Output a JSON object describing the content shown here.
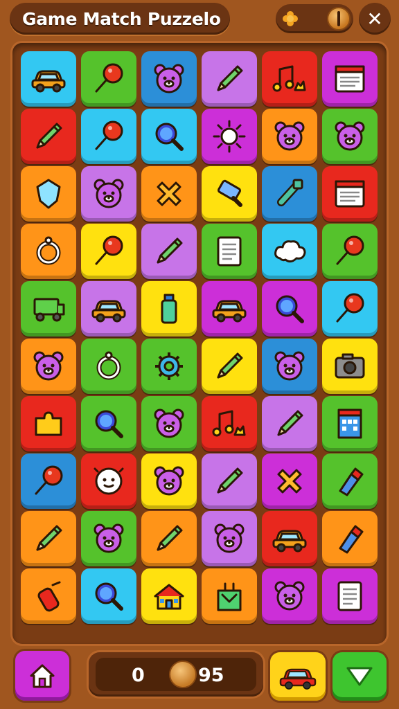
{
  "header": {
    "title": "Game Match Puzzelo"
  },
  "footer": {
    "score_left": "0",
    "score_right": "95"
  },
  "colors": {
    "cyan": "#33c8f2",
    "green": "#55c22c",
    "blue": "#2c8fd8",
    "violet": "#c774e8",
    "red": "#e8281e",
    "magenta": "#cc2fd8",
    "orange": "#ff9418",
    "yellow": "#ffe10f",
    "wood": "#a0561f"
  },
  "board": {
    "rows": [
      [
        "cyan:car-icon",
        "green:lollipop-icon",
        "blue:bear-icon",
        "violet:pencil-icon",
        "red:music-note-icon",
        "magenta:notebook-icon"
      ],
      [
        "red:pencil-icon",
        "cyan:lollipop-icon",
        "cyan:magnifier-icon",
        "magenta:sun-icon",
        "orange:bear-icon",
        "green:bear-icon"
      ],
      [
        "orange:shield-icon",
        "violet:bear-icon",
        "orange:cross-icon",
        "yellow:paint-roller-icon",
        "blue:bone-icon",
        "red:notebook-icon"
      ],
      [
        "orange:ring-icon",
        "yellow:lollipop-icon",
        "violet:pencil-icon",
        "green:document-icon",
        "cyan:cloud-icon",
        "green:lollipop-icon"
      ],
      [
        "green:truck-icon",
        "violet:car-icon",
        "yellow:bottle-icon",
        "magenta:car-icon",
        "magenta:magnifier-icon",
        "cyan:lollipop-icon"
      ],
      [
        "orange:bear-icon",
        "green:ring-icon",
        "green:gear-icon",
        "yellow:pencil-icon",
        "blue:bear-icon",
        "yellow:camera-icon"
      ],
      [
        "red:puzzle-piece-icon",
        "green:magnifier-icon",
        "green:bear-icon",
        "red:music-note-icon",
        "violet:pencil-icon",
        "green:building-icon"
      ],
      [
        "blue:lollipop-icon",
        "red:clock-icon",
        "yellow:bear-icon",
        "violet:pencil-icon",
        "magenta:cross-icon",
        "green:marker-icon"
      ],
      [
        "orange:pencil-icon",
        "green:bear-icon",
        "orange:pencil-icon",
        "violet:bear-icon",
        "red:car-icon",
        "orange:marker-icon"
      ],
      [
        "orange:fire-extinguisher-icon",
        "cyan:magnifier-icon",
        "yellow:house-icon",
        "orange:shopping-bag-icon",
        "magenta:bear-icon",
        "magenta:document-icon"
      ]
    ]
  }
}
